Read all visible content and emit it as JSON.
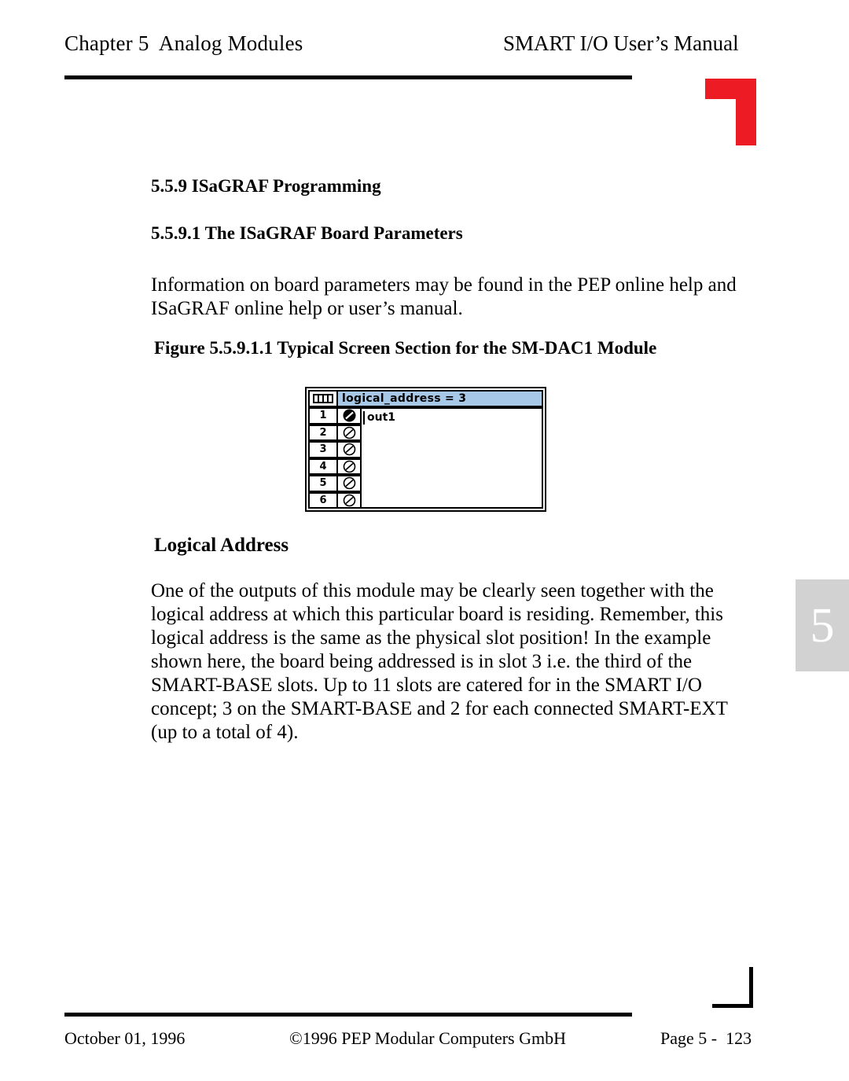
{
  "header": {
    "chapter": "Chapter 5  Analog Modules",
    "manual_title": "SMART I/O User’s Manual",
    "accent_color": "#ed1c24"
  },
  "content": {
    "heading_559": "5.5.9 ISaGRAF Programming",
    "heading_5591": "5.5.9.1 The ISaGRAF Board Parameters",
    "paragraph_info": "Information on board parameters may be found in the PEP online help and ISaGRAF online help or user’s manual.",
    "figure_caption": "Figure 5.5.9.1.1 Typical Screen Section for the SM-DAC1 Module",
    "heading_logical_address": "Logical Address",
    "paragraph_main": "One of the outputs of this module may be clearly seen together with the logical address at which this particular board is residing. Remember, this logical address is the same as the physical slot position! In the example shown here, the board being addressed is in slot 3 i.e. the third of the SMART-BASE slots. Up to 11 slots are catered for in the SMART I/O concept; 3 on the SMART-BASE and 2 for each connected SMART-EXT (up to a total of 4)."
  },
  "figure_widget": {
    "titlebar_icon": "dip-switch-icon",
    "title": "logical_address = 3",
    "titlebar_color": "#a8c8e8",
    "content_value": "out1",
    "channels": [
      {
        "number": "1",
        "icon": "slashed-circle-icon-filled",
        "selected": true
      },
      {
        "number": "2",
        "icon": "slashed-circle-icon",
        "selected": false
      },
      {
        "number": "3",
        "icon": "slashed-circle-icon",
        "selected": false
      },
      {
        "number": "4",
        "icon": "slashed-circle-icon",
        "selected": false
      },
      {
        "number": "5",
        "icon": "slashed-circle-icon",
        "selected": false
      },
      {
        "number": "6",
        "icon": "slashed-circle-icon",
        "selected": false
      }
    ]
  },
  "chapter_tab": {
    "number": "5",
    "background_color": "#d2d2d2"
  },
  "footer": {
    "date": "October 01, 1996",
    "copyright": "©1996 PEP Modular Computers GmbH",
    "page": "Page 5 -  123"
  }
}
